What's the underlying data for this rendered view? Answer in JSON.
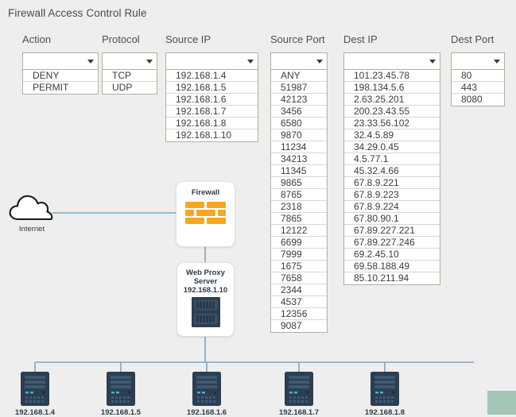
{
  "header": {
    "title": "Firewall Access Control Rule"
  },
  "colors": {
    "page_background": "#eeeeee",
    "link_line": "#7ba7c7",
    "firewall_brick": "#f5a623",
    "server_body": "#2c3e50",
    "corner_block": "#a4c6b6",
    "dropdown_border": "#b3b09a"
  },
  "rule_columns": [
    {
      "name": "action",
      "header": "Action",
      "selected": "",
      "placeholder": "",
      "options": [
        "DENY",
        "PERMIT"
      ]
    },
    {
      "name": "protocol",
      "header": "Protocol",
      "selected": "",
      "placeholder": "",
      "options": [
        "TCP",
        "UDP"
      ]
    },
    {
      "name": "source-ip",
      "header": "Source IP",
      "selected": "",
      "placeholder": "",
      "options": [
        "192.168.1.4",
        "192.168.1.5",
        "192.168.1.6",
        "192.168.1.7",
        "192.168.1.8",
        "192.168.1.10"
      ]
    },
    {
      "name": "source-port",
      "header": "Source Port",
      "selected": "",
      "placeholder": "",
      "options": [
        "ANY",
        "51987",
        "42123",
        "3456",
        "6580",
        "9870",
        "11234",
        "34213",
        "11345",
        "9865",
        "8765",
        "2318",
        "7865",
        "12122",
        "6699",
        "7999",
        "1675",
        "7658",
        "2344",
        "4537",
        "12356",
        "9087"
      ]
    },
    {
      "name": "dest-ip",
      "header": "Dest IP",
      "selected": "",
      "placeholder": "",
      "options": [
        "101.23.45.78",
        "198.134.5.6",
        "2.63.25.201",
        "200.23.43.55",
        "23.33.56.102",
        "32.4.5.89",
        "34.29.0.45",
        "4.5.77.1",
        "45.32.4.66",
        "67.8.9.221",
        "67.8.9.223",
        "67.8.9.224",
        "67.80.90.1",
        "67.89.227.221",
        "67.89.227.246",
        "69.2.45.10",
        "69.58.188.49",
        "85.10.211.94"
      ]
    },
    {
      "name": "dest-port",
      "header": "Dest Port",
      "selected": "",
      "placeholder": "",
      "options": [
        "80",
        "443",
        "8080"
      ]
    }
  ],
  "diagram": {
    "internet": {
      "label": "Internet",
      "icon": "cloud-icon"
    },
    "firewall": {
      "label": "Firewall",
      "icon": "brick-wall-icon"
    },
    "proxy": {
      "label_line1": "Web Proxy",
      "label_line2": "Server",
      "label_line3": "192.168.1.10",
      "icon": "server-rack-icon"
    },
    "hosts": [
      {
        "label": "192.168.1.4",
        "icon": "server-tower-icon"
      },
      {
        "label": "192.168.1.5",
        "icon": "server-tower-icon"
      },
      {
        "label": "192.168.1.6",
        "icon": "server-tower-icon"
      },
      {
        "label": "192.168.1.7",
        "icon": "server-tower-icon"
      },
      {
        "label": "192.168.1.8",
        "icon": "server-tower-icon"
      }
    ]
  }
}
